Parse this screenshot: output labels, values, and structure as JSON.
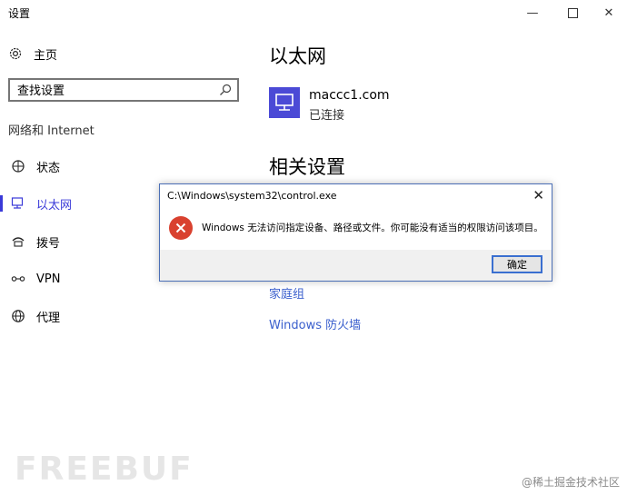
{
  "window": {
    "title": "设置",
    "minimize": "—",
    "close": "✕"
  },
  "sidebar": {
    "home_label": "主页",
    "search_placeholder": "查找设置",
    "section_label": "网络和 Internet",
    "items": [
      {
        "label": "状态",
        "icon": "status-icon"
      },
      {
        "label": "以太网",
        "icon": "ethernet-icon",
        "active": true
      },
      {
        "label": "拨号",
        "icon": "dialup-icon"
      },
      {
        "label": "VPN",
        "icon": "vpn-icon"
      },
      {
        "label": "代理",
        "icon": "proxy-icon"
      }
    ]
  },
  "main": {
    "title": "以太网",
    "network_name": "maccc1.com",
    "network_status": "已连接",
    "related_title": "相关设置",
    "links": [
      "家庭组",
      "Windows 防火墙"
    ]
  },
  "dialog": {
    "title": "C:\\Windows\\system32\\control.exe",
    "close": "✕",
    "message": "Windows 无法访问指定设备、路径或文件。你可能没有适当的权限访问该项目。",
    "ok_label": "确定"
  },
  "watermark": {
    "logo": "FREEBUF",
    "credit": "@稀土掘金技术社区"
  },
  "colors": {
    "accent": "#3a3ad8",
    "link": "#3a5fcd",
    "error": "#d9412f"
  }
}
